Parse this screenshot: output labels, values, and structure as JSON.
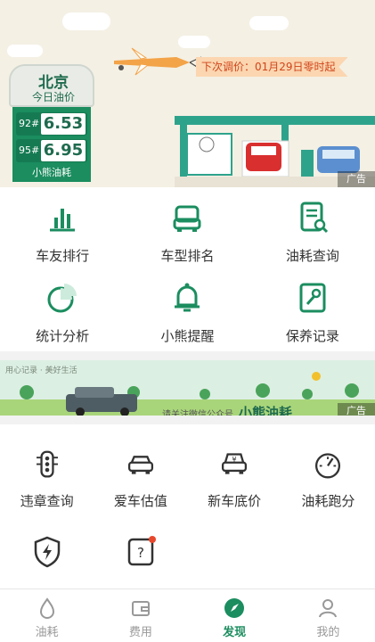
{
  "colors": {
    "brand": "#1b8d5f",
    "text": "#333333",
    "inactive": "#999999",
    "notice": "#d0451b"
  },
  "top_banner": {
    "city": "北京",
    "subtitle": "今日油价",
    "prices": [
      {
        "grade": "92#",
        "value": "6.53"
      },
      {
        "grade": "95#",
        "value": "6.95"
      }
    ],
    "brand": "小熊油耗",
    "next_adjust": "下次调价：01月29日零时起",
    "ad_label": "广告"
  },
  "grid_a": [
    {
      "label": "车友排行",
      "icon": "bar-chart-icon"
    },
    {
      "label": "车型排名",
      "icon": "car-front-icon"
    },
    {
      "label": "油耗查询",
      "icon": "document-search-icon"
    },
    {
      "label": "统计分析",
      "icon": "pie-chart-icon"
    },
    {
      "label": "小熊提醒",
      "icon": "bell-icon"
    },
    {
      "label": "保养记录",
      "icon": "wrench-icon"
    }
  ],
  "mid_banner": {
    "slogan": "用心记录 · 美好生活",
    "text": "请关注微信公众号",
    "brand": "小熊油耗",
    "ad_label": "广告"
  },
  "grid_b": [
    {
      "label": "违章查询",
      "icon": "traffic-light-icon"
    },
    {
      "label": "爱车估值",
      "icon": "car-icon"
    },
    {
      "label": "新车底价",
      "icon": "car-price-icon"
    },
    {
      "label": "油耗跑分",
      "icon": "speedometer-icon"
    },
    {
      "label": "",
      "icon": "shield-bolt-icon"
    },
    {
      "label": "",
      "icon": "help-badge-icon"
    }
  ],
  "nav": [
    {
      "label": "油耗",
      "icon": "drop-icon",
      "active": false
    },
    {
      "label": "费用",
      "icon": "wallet-icon",
      "active": false
    },
    {
      "label": "发现",
      "icon": "compass-icon",
      "active": true
    },
    {
      "label": "我的",
      "icon": "person-icon",
      "active": false
    }
  ]
}
